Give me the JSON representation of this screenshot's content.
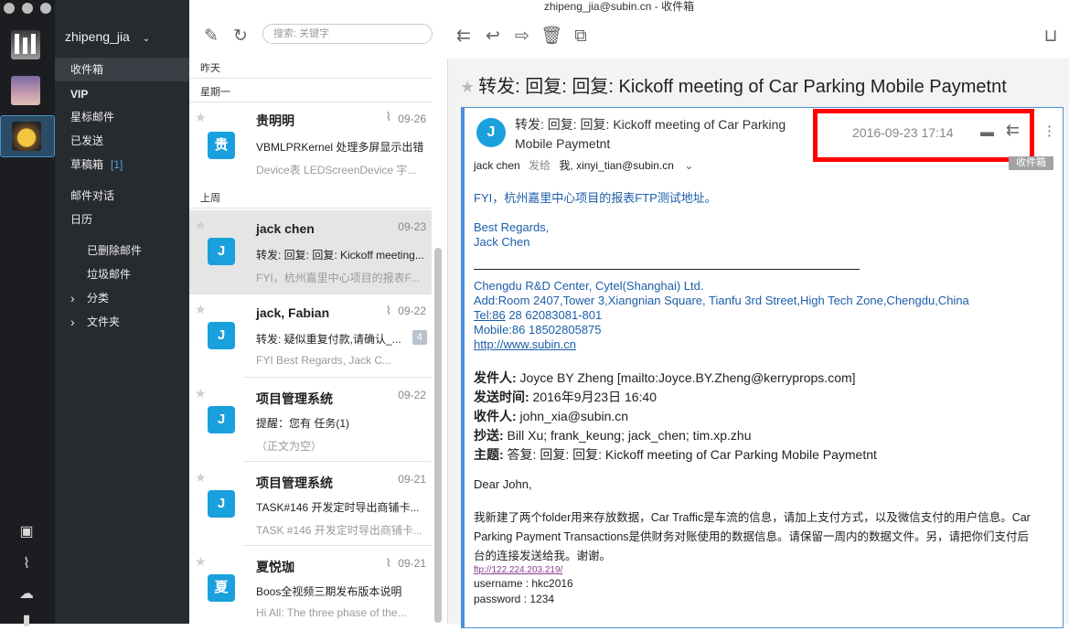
{
  "window": {
    "title": "zhipeng_jia@subin.cn  -  收件箱"
  },
  "account": {
    "name": "zhipeng_jia"
  },
  "folders": [
    {
      "label": "收件箱",
      "active": true
    },
    {
      "label": "VIP"
    },
    {
      "label": "星标邮件"
    },
    {
      "label": "已发送"
    },
    {
      "label": "草稿箱",
      "count": "[1]"
    },
    {
      "label": "邮件对话"
    },
    {
      "label": "日历"
    },
    {
      "label": "已删除邮件"
    },
    {
      "label": "垃圾邮件"
    },
    {
      "label": "分类",
      "expand": "›"
    },
    {
      "label": "文件夹",
      "expand": "›"
    }
  ],
  "search": {
    "placeholder": "搜索: 关键字"
  },
  "list": {
    "sections": [
      "昨天",
      "星期一",
      "上周"
    ],
    "mails": [
      {
        "sender": "贵明明",
        "date": "09-26",
        "avatar": "贵",
        "subject": "VBMLPRKernel 处理多屏显示出错",
        "preview": "Device表 LEDScreenDevice 字...",
        "clip": true
      },
      {
        "sender": "jack chen",
        "date": "09-23",
        "avatar": "J",
        "subject": "转发: 回复: 回复: Kickoff meeting...",
        "preview": "FYI，杭州嘉里中心项目的报表F...",
        "selected": true
      },
      {
        "sender": "jack, Fabian",
        "date": "09-22",
        "avatar": "J",
        "subject": "转发: 疑似重复付款,请确认_...",
        "preview": "FYI         Best Regards,    Jack C...",
        "badge": "4",
        "clip": true
      },
      {
        "sender": "项目管理系统",
        "date": "09-22",
        "avatar": "J",
        "subject": "提醒：您有 任务(1)",
        "preview": "（正文为空）"
      },
      {
        "sender": "项目管理系统",
        "date": "09-21",
        "avatar": "J",
        "subject": "TASK#146 开发定时导出商铺卡...",
        "preview": "TASK #146 开发定时导出商铺卡..."
      },
      {
        "sender": "夏悦珈",
        "date": "09-21",
        "avatar": "夏",
        "subject": "Boos全视频三期发布版本说明",
        "preview": "Hi All:     The three phase of the...",
        "clip": true
      }
    ]
  },
  "reader": {
    "subject": "转发: 回复: 回复: Kickoff meeting of Car Parking Mobile Paymetnt",
    "card_subject": "转发: 回复: 回复: Kickoff meeting of Car Parking Mobile Paymetnt",
    "avatar": "J",
    "date": "2016-09-23 17:14",
    "from": "jack chen",
    "sent_to_label": "发给",
    "recipients": "我, xinyi_tian@subin.cn",
    "folder_tag": "收件箱",
    "body": {
      "fyi": "FYI，杭州嘉里中心项目的报表FTP测试地址。",
      "regards1": "Best Regards,",
      "regards2": "Jack Chen",
      "company": "Chengdu R&D Center, Cytel(Shanghai) Ltd.",
      "address": "Add:Room 2407,Tower 3,Xiangnian Square, Tianfu 3rd Street,High Tech Zone,Chengdu,China",
      "tel_label": "Tel:86",
      "tel_rest": " 28 62083081-801",
      "mobile": "Mobile:86 18502805875",
      "website": "http://www.subin.cn",
      "from_label": "发件人:",
      "from_value": " Joyce BY Zheng [mailto:Joyce.BY.Zheng@kerryprops.com]",
      "sent_label": "发送时间:",
      "sent_value": " 2016年9月23日 16:40",
      "to_label": "收件人:",
      "to_value": " john_xia@subin.cn",
      "cc_label": "抄送:",
      "cc_value": " Bill Xu; frank_keung; jack_chen; tim.xp.zhu",
      "subj_label": "主题:",
      "subj_value": " 答复: 回复: 回复: Kickoff meeting of Car Parking Mobile Paymetnt",
      "greeting": "Dear John,",
      "para1": "我新建了两个folder用来存放数据，Car Traffic是车流的信息，请加上支付方式，以及微信支付的用户信息。Car",
      "para2": "Parking Payment Transactions是供财务对账使用的数据信息。请保留一周内的数据文件。另，请把你们支付后",
      "para3": "台的连接发送给我。谢谢。",
      "ftp": "ftp://122.224.203.219/",
      "username": "username : hkc2016",
      "password": "password : 1234"
    }
  },
  "colors": {
    "accent": "#1aa0dd",
    "highlight": "#ff0000",
    "sidebar": "#272a2e",
    "rail": "#1b1d20"
  }
}
